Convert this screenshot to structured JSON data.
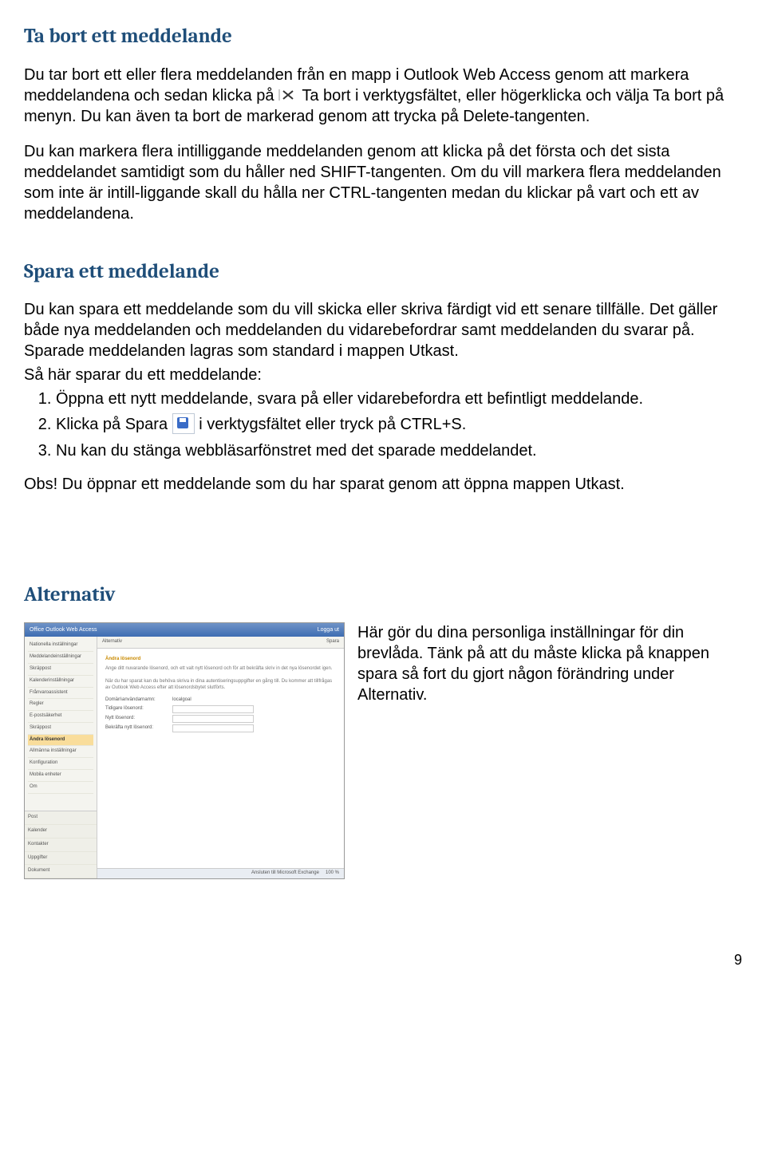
{
  "section1": {
    "heading": "Ta bort ett meddelande",
    "p1a": "Du tar bort ett eller flera meddelanden från en mapp i Outlook Web Access genom att markera meddelandena och sedan klicka på ",
    "p1b": " Ta bort i verktygsfältet, eller högerklicka och välja Ta bort på menyn. Du kan även ta bort de markerad genom att trycka på Delete-tangenten.",
    "p2": "Du kan markera flera intilliggande meddelanden genom att klicka på det första och det sista meddelandet samtidigt som du håller ned SHIFT-tangenten. Om du vill markera flera meddelanden som inte är intill-liggande skall du hålla ner CTRL-tangenten medan du klickar på vart och ett av meddelandena."
  },
  "section2": {
    "heading": "Spara ett meddelande",
    "p1": "Du kan spara ett meddelande som du vill skicka eller skriva färdigt vid ett senare tillfälle. Det gäller både nya meddelanden och meddelanden du vidarebefordrar samt meddelanden du svarar på. Sparade meddelanden lagras som standard i mappen Utkast.",
    "p2": "Så här sparar du ett meddelande:",
    "li1": "Öppna ett nytt meddelande, svara på eller vidarebefordra ett befintligt meddelande.",
    "li2a": "Klicka på Spara ",
    "li2b": " i verktygsfältet eller tryck på CTRL+S.",
    "li3": "Nu kan du stänga webbläsarfönstret med det sparade meddelandet.",
    "obs": "Obs! Du öppnar ett meddelande som du har sparat genom att öppna mappen Utkast."
  },
  "section3": {
    "heading": "Alternativ",
    "text": "Här gör du dina personliga inställningar för din brevlåda. Tänk på att du måste klicka på knappen spara så fort du gjort någon förändring under Alternativ."
  },
  "owa": {
    "brand": "Office Outlook Web Access",
    "logout": "Logga ut",
    "toolbar_title": "Alternativ",
    "toolbar_save": "Spara",
    "side_top": [
      "Nationella inställningar",
      "Meddelandeinställningar",
      "Skräppost",
      "Kalenderinställningar",
      "Frånvaroassistent",
      "Regler",
      "E-postsäkerhet",
      "Skräppost"
    ],
    "side_active": "Ändra lösenord",
    "side_top2": [
      "Allmänna inställningar",
      "Konfiguration",
      "Mobila enheter",
      "Om"
    ],
    "side_bottom": [
      "Post",
      "Kalender",
      "Kontakter",
      "Uppgifter",
      "Dokument"
    ],
    "content_title": "Ändra lösenord",
    "content_desc1": "Ange ditt nuvarande lösenord, och ett valt nytt lösenord och för att bekräfta skriv in det nya lösenordet igen.",
    "content_desc2": "När du har sparat kan du behöva skriva in dina autentiseringsuppgifter en gång till. Du kommer att tillfrågas av Outlook Web Access efter att lösenordsbytet slutförts.",
    "fields": [
      "Domän\\användarnamn:",
      "Tidigare lösenord:",
      "Nytt lösenord:",
      "Bekräfta nytt lösenord:"
    ],
    "field_val": "localgoal",
    "footer_left": "Ansluten till Microsoft Exchange",
    "footer_right": "100 %"
  },
  "page_number": "9"
}
